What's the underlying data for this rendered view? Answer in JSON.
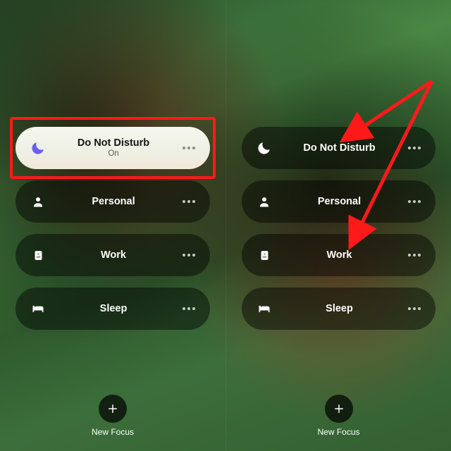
{
  "left": {
    "items": [
      {
        "icon": "moon",
        "label": "Do Not Disturb",
        "sub": "On",
        "active": true,
        "highlighted": true
      },
      {
        "icon": "person",
        "label": "Personal",
        "sub": "",
        "active": false,
        "highlighted": false
      },
      {
        "icon": "badge",
        "label": "Work",
        "sub": "",
        "active": false,
        "highlighted": false
      },
      {
        "icon": "bed",
        "label": "Sleep",
        "sub": "",
        "active": false,
        "highlighted": false
      }
    ],
    "new_focus_label": "New Focus"
  },
  "right": {
    "items": [
      {
        "icon": "moon",
        "label": "Do Not Disturb",
        "sub": "",
        "active": false,
        "highlighted": false
      },
      {
        "icon": "person",
        "label": "Personal",
        "sub": "",
        "active": false,
        "highlighted": false
      },
      {
        "icon": "badge",
        "label": "Work",
        "sub": "",
        "active": false,
        "highlighted": false
      },
      {
        "icon": "bed",
        "label": "Sleep",
        "sub": "",
        "active": false,
        "highlighted": false
      }
    ],
    "new_focus_label": "New Focus"
  },
  "annotations": {
    "highlight_color": "#ff1a1a",
    "arrow_color": "#ff1a1a"
  }
}
